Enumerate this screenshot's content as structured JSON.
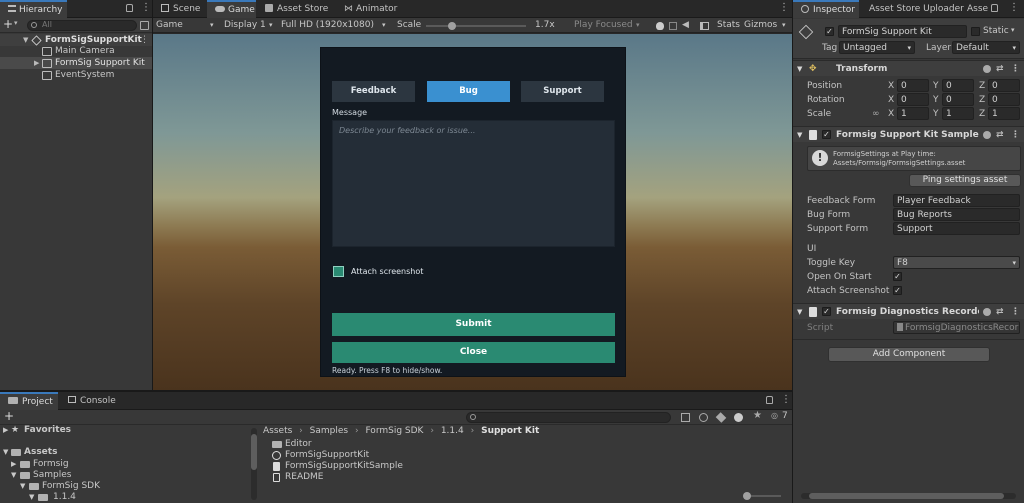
{
  "hierarchy": {
    "tab_label": "Hierarchy",
    "search_placeholder": "All",
    "add_label": "+",
    "scene_name": "FormSigSupportKit",
    "items": [
      "Main Camera",
      "FormSig Support Kit",
      "EventSystem"
    ]
  },
  "center_tabs": [
    "Scene",
    "Game",
    "Asset Store",
    "Animator"
  ],
  "game_toolbar": {
    "mode": "Game",
    "display": "Display 1",
    "resolution": "Full HD (1920x1080)",
    "scale_label": "Scale",
    "scale_value": 0.12,
    "scale_text": "1.7x",
    "play_mode": "Play Focused",
    "stats_label": "Stats",
    "gizmos_label": "Gizmos"
  },
  "form": {
    "tabs": [
      "Feedback",
      "Bug",
      "Support"
    ],
    "active_tab": "Bug",
    "message_label": "Message",
    "message_placeholder": "Describe your feedback or issue...",
    "attach_label": "Attach screenshot",
    "attach_checked": true,
    "submit_label": "Submit",
    "close_label": "Close",
    "status_text": "Ready. Press F8 to hide/show.",
    "accent_color": "#2a8a72",
    "tab_active_color": "#3a90d0"
  },
  "inspector": {
    "tabs": [
      "Inspector",
      "Asset Store Uploader",
      "Asse"
    ],
    "object_name": "FormSig Support Kit",
    "static_label": "Static",
    "tag_label": "Tag",
    "tag_value": "Untagged",
    "layer_label": "Layer",
    "layer_value": "Default",
    "transform": {
      "title": "Transform",
      "rows": [
        {
          "label": "Position",
          "x": "0",
          "y": "0",
          "z": "0"
        },
        {
          "label": "Rotation",
          "x": "0",
          "y": "0",
          "z": "0"
        },
        {
          "label": "Scale",
          "x": "1",
          "y": "1",
          "z": "1"
        }
      ],
      "axis_labels": [
        "X",
        "Y",
        "Z"
      ]
    },
    "sample": {
      "title": "Formsig Support Kit Sample (Scrip",
      "info_line1": "FormsigSettings at Play time:",
      "info_line2": "Assets/Formsig/FormsigSettings.asset",
      "ping_label": "Ping settings asset",
      "fields": [
        {
          "label": "Feedback Form",
          "value": "Player Feedback"
        },
        {
          "label": "Bug Form",
          "value": "Bug Reports"
        },
        {
          "label": "Support Form",
          "value": "Support"
        }
      ],
      "ui_header": "UI",
      "toggle_key_label": "Toggle Key",
      "toggle_key_value": "F8",
      "open_on_start_label": "Open On Start",
      "attach_screenshot_label": "Attach Screenshot O",
      "checkmark": "✓"
    },
    "recorder": {
      "title": "Formsig Diagnostics Recorder (Scr",
      "script_label": "Script",
      "script_value": "FormsigDiagnosticsRecor"
    },
    "add_component_label": "Add Component"
  },
  "bottom": {
    "tabs": [
      "Project",
      "Console"
    ],
    "favorites_label": "Favorites",
    "tree": [
      "Assets",
      "Formsig",
      "Samples",
      "FormSig SDK",
      "1.1.4"
    ],
    "breadcrumb": [
      "Assets",
      "Samples",
      "FormSig SDK",
      "1.1.4",
      "Support Kit"
    ],
    "files": [
      "Editor",
      "FormSigSupportKit",
      "FormSigSupportKitSample",
      "README"
    ],
    "count_badge": "7"
  }
}
